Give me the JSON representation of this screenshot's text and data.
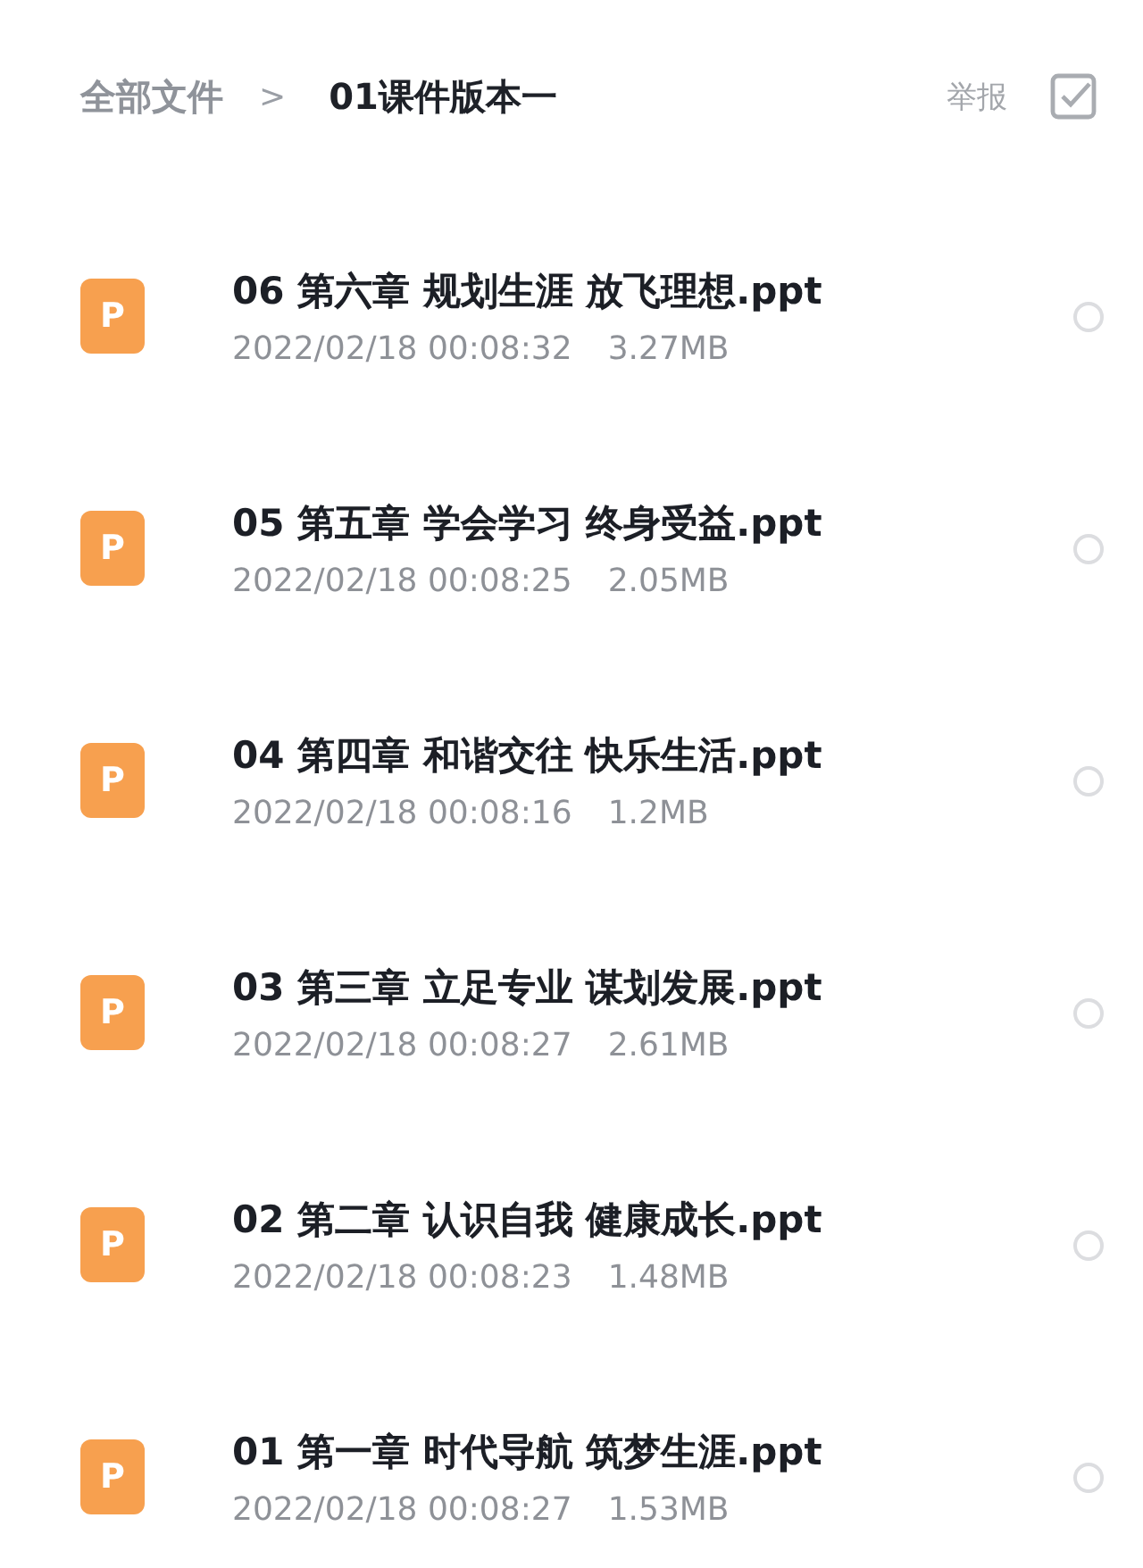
{
  "breadcrumb": {
    "root": "全部文件",
    "separator": ">",
    "current": "01课件版本一"
  },
  "actions": {
    "report": "举报",
    "select_all_checked": false
  },
  "files": [
    {
      "icon_label": "P",
      "name": "06 第六章 规划生涯 放飞理想.ppt",
      "date": "2022/02/18 00:08:32",
      "size": "3.27MB",
      "selected": false
    },
    {
      "icon_label": "P",
      "name": "05 第五章 学会学习 终身受益.ppt",
      "date": "2022/02/18 00:08:25",
      "size": "2.05MB",
      "selected": false
    },
    {
      "icon_label": "P",
      "name": "04 第四章 和谐交往 快乐生活.ppt",
      "date": "2022/02/18 00:08:16",
      "size": "1.2MB",
      "selected": false
    },
    {
      "icon_label": "P",
      "name": "03 第三章 立足专业 谋划发展.ppt",
      "date": "2022/02/18 00:08:27",
      "size": "2.61MB",
      "selected": false
    },
    {
      "icon_label": "P",
      "name": "02 第二章 认识自我 健康成长.ppt",
      "date": "2022/02/18 00:08:23",
      "size": "1.48MB",
      "selected": false
    },
    {
      "icon_label": "P",
      "name": "01 第一章 时代导航 筑梦生涯.ppt",
      "date": "2022/02/18 00:08:27",
      "size": "1.53MB",
      "selected": false
    }
  ]
}
